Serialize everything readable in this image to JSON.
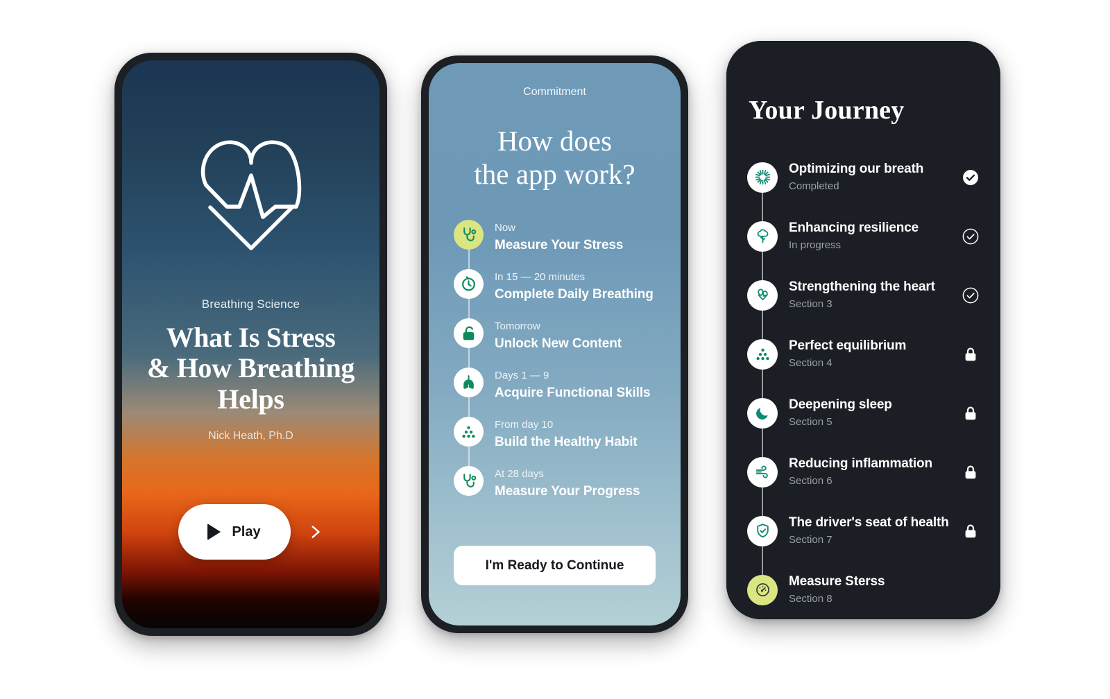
{
  "phone1": {
    "logo_icon": "heart-pulse-icon",
    "eyebrow": "Breathing Science",
    "title_line1": "What Is Stress",
    "title_line2": "& How Breathing",
    "title_line3": "Helps",
    "author": "Nick Heath, Ph.D",
    "play_label": "Play",
    "play_icon": "play-triangle-icon",
    "next_icon": "chevron-right-icon"
  },
  "phone2": {
    "eyebrow": "Commitment",
    "title_line1": "How does",
    "title_line2": "the app work?",
    "cta_label": "I'm Ready to Continue",
    "steps": [
      {
        "when": "Now",
        "what": "Measure Your Stress",
        "icon": "stethoscope-icon",
        "accent": true
      },
      {
        "when": "In 15 — 20 minutes",
        "what": "Complete Daily Breathing",
        "icon": "timer-icon",
        "accent": false
      },
      {
        "when": "Tomorrow",
        "what": "Unlock New Content",
        "icon": "unlock-padlock-icon",
        "accent": false
      },
      {
        "when": "Days 1 — 9",
        "what": "Acquire Functional Skills",
        "icon": "lungs-icon",
        "accent": false
      },
      {
        "when": "From day 10",
        "what": "Build the Healthy Habit",
        "icon": "dots-pyramid-icon",
        "accent": false
      },
      {
        "when": "At 28 days",
        "what": "Measure Your Progress",
        "icon": "stethoscope-icon",
        "accent": false
      }
    ]
  },
  "phone3": {
    "title": "Your Journey",
    "items": [
      {
        "name": "Optimizing our breath",
        "status": "Completed",
        "icon": "burst-icon",
        "state": "check-filled-icon",
        "accent": false
      },
      {
        "name": "Enhancing resilience",
        "status": "In progress",
        "icon": "tree-icon",
        "state": "check-outline-icon",
        "accent": false
      },
      {
        "name": "Strengthening the heart",
        "status": "Section 3",
        "icon": "heart-pulse-icon",
        "state": "check-outline-icon",
        "accent": false
      },
      {
        "name": "Perfect equilibrium",
        "status": "Section 4",
        "icon": "dots-pyramid-icon",
        "state": "lock-icon",
        "accent": false
      },
      {
        "name": "Deepening sleep",
        "status": "Section 5",
        "icon": "moon-icon",
        "state": "lock-icon",
        "accent": false
      },
      {
        "name": "Reducing inflammation",
        "status": "Section 6",
        "icon": "wind-icon",
        "state": "lock-icon",
        "accent": false
      },
      {
        "name": "The driver's seat of health",
        "status": "Section 7",
        "icon": "shield-check-icon",
        "state": "lock-icon",
        "accent": false
      },
      {
        "name": "Measure Sterss",
        "status": "Section 8",
        "icon": "gauge-icon",
        "state": "none",
        "accent": true
      }
    ]
  },
  "colors": {
    "phone_frame": "#1c1f24",
    "dark_screen": "#1b1e24",
    "accent_lime": "#dbe683",
    "icon_green": "#0f8a5f",
    "icon_teal": "#0e8a72",
    "muted_text": "#9aa0a6"
  }
}
